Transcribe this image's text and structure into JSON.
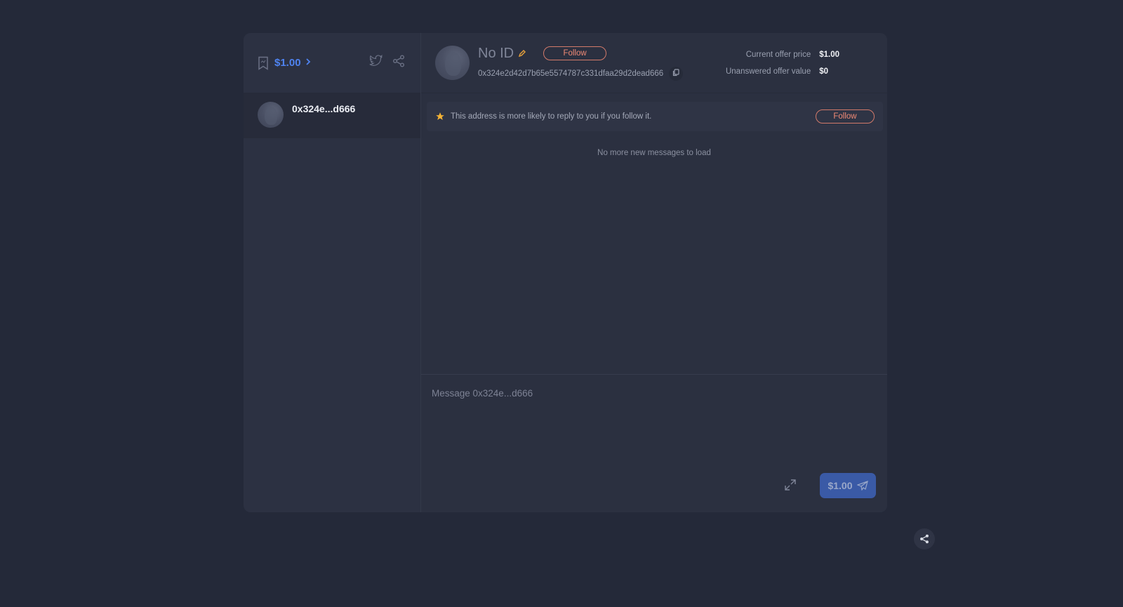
{
  "sidebar": {
    "balance_label": "$1.00",
    "conversations": [
      {
        "name": "0x324e...d666"
      }
    ]
  },
  "header": {
    "title": "No ID",
    "follow_label": "Follow",
    "address": "0x324e2d42d7b65e5574787c331dfaa29d2dead666",
    "stats": [
      {
        "label": "Current offer price",
        "value": "$1.00"
      },
      {
        "label": "Unanswered offer value",
        "value": "$0"
      }
    ]
  },
  "banner": {
    "text": "This address is more likely to reply to you if you follow it.",
    "follow_label": "Follow"
  },
  "messages": {
    "status": "No more new messages to load"
  },
  "composer": {
    "placeholder": "Message 0x324e...d666",
    "value": "",
    "send_label": "$1.00"
  },
  "colors": {
    "accent_blue": "#4f83f0",
    "follow_red": "#f08a75",
    "star": "#f5b335",
    "send_button": "#3a5aa6"
  }
}
